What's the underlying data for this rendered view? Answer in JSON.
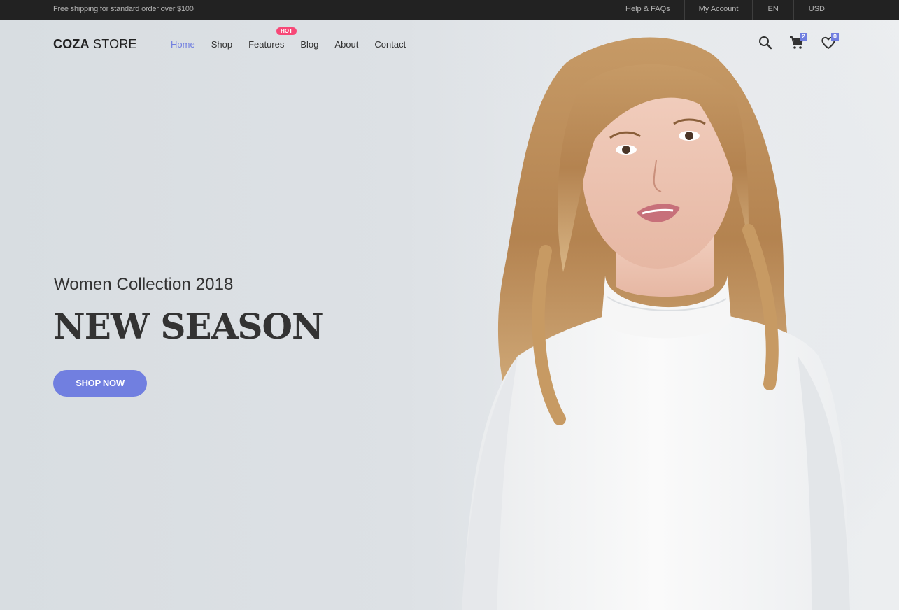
{
  "topbar": {
    "promo": "Free shipping for standard order over $100",
    "links": [
      "Help & FAQs",
      "My Account",
      "EN",
      "USD"
    ]
  },
  "brand": {
    "bold": "COZA",
    "light": " STORE"
  },
  "nav": {
    "items": [
      "Home",
      "Shop",
      "Features",
      "Blog",
      "About",
      "Contact"
    ],
    "active": "Home",
    "hot_label": "HOT"
  },
  "header_icons": {
    "search_icon": "search-icon",
    "cart_icon": "cart-icon",
    "cart_count": "2",
    "wishlist_icon": "heart-icon",
    "wishlist_count": "0"
  },
  "hero": {
    "subtitle": "Women Collection 2018",
    "headline": "NEW SEASON",
    "cta": "SHOP NOW"
  },
  "colors": {
    "accent": "#717fe0",
    "hot": "#f74877",
    "topbar_bg": "#222222",
    "text": "#333333"
  }
}
